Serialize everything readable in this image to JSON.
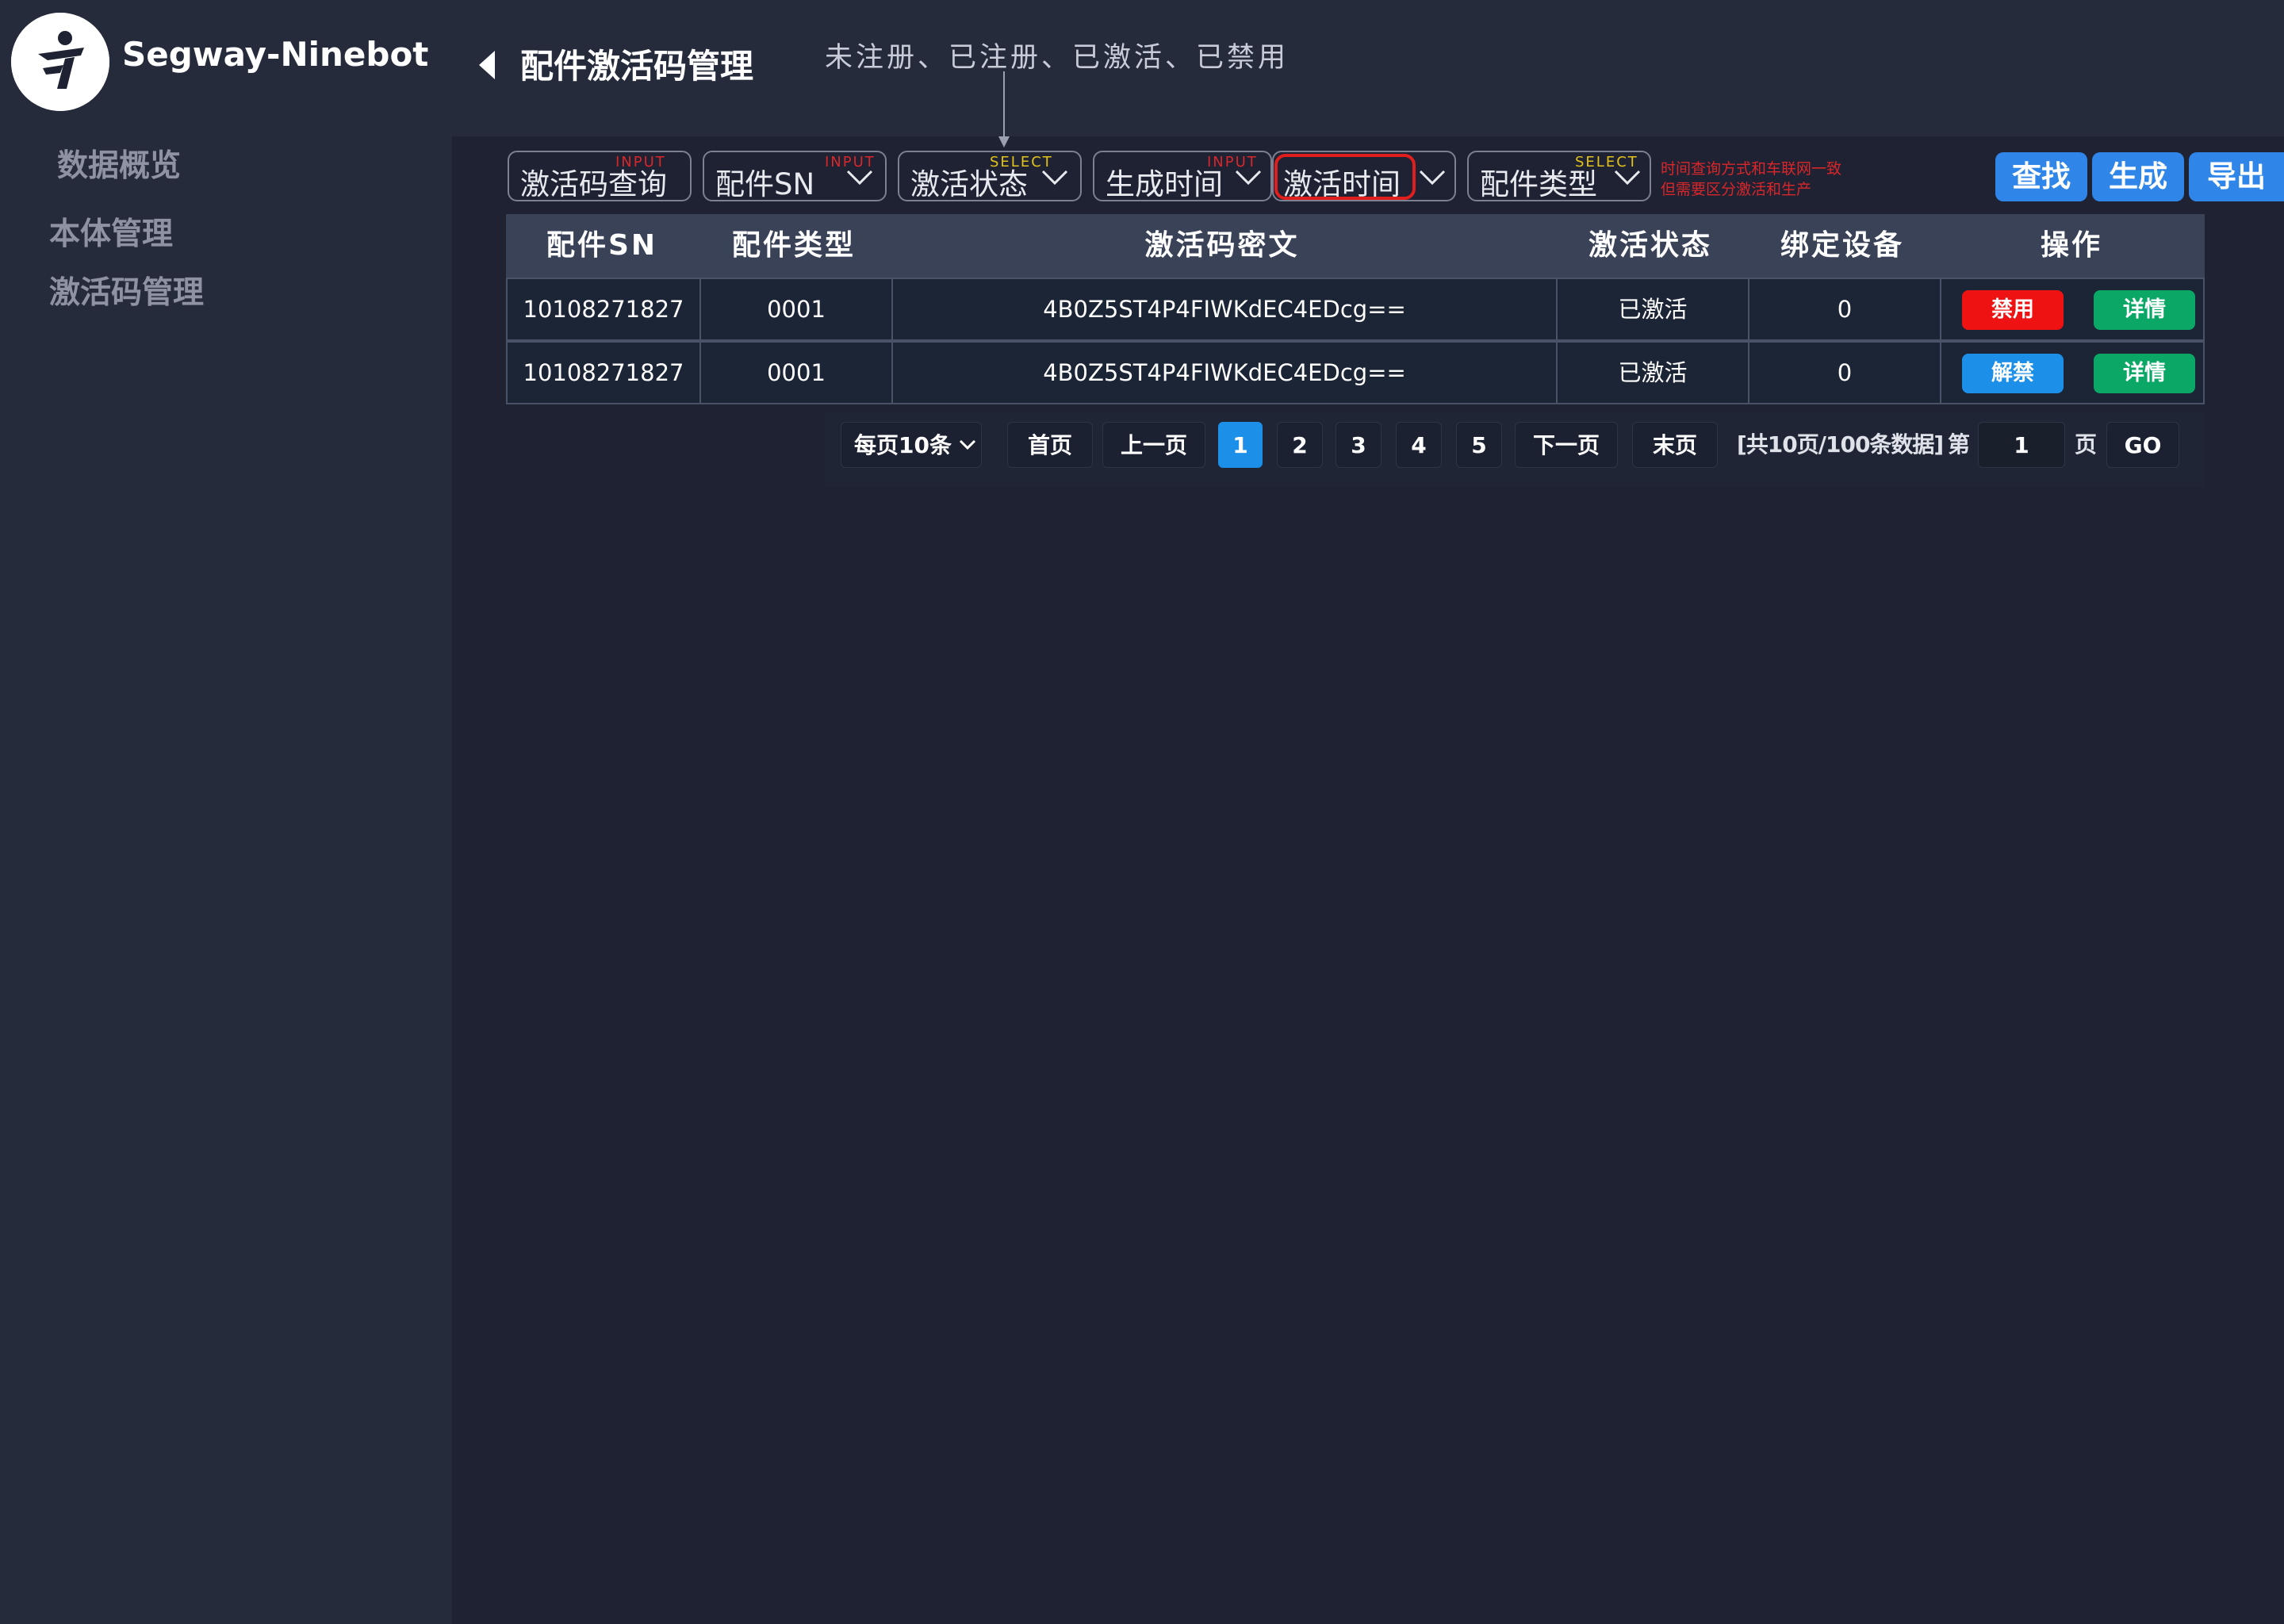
{
  "header": {
    "brand": "Segway-Ninebot",
    "page_title": "配件激活码管理",
    "annotation": "未注册、已注册、已激活、已禁用"
  },
  "sidebar": {
    "items": [
      {
        "label": "数据概览"
      },
      {
        "label": "本体管理"
      },
      {
        "label": "激活码管理"
      }
    ]
  },
  "filters": [
    {
      "label": "激活码查询",
      "tag": "INPUT",
      "tag_color": "#d9262a"
    },
    {
      "label": "配件SN",
      "tag": "INPUT",
      "tag_color": "#d9262a"
    },
    {
      "label": "激活状态",
      "tag": "SELECT",
      "tag_color": "#e2c21b"
    },
    {
      "label": "生成时间",
      "tag": "INPUT",
      "tag_color": "#d9262a"
    },
    {
      "label": "激活时间",
      "tag": "",
      "tag_color": ""
    },
    {
      "label": "配件类型",
      "tag": "SELECT",
      "tag_color": "#e2c21b"
    }
  ],
  "note": {
    "line1": "时间查询方式和车联网一致",
    "line2": "但需要区分激活和生产"
  },
  "actions": {
    "search": "查找",
    "generate": "生成",
    "export": "导出"
  },
  "table": {
    "headers": [
      "配件SN",
      "配件类型",
      "激活码密文",
      "激活状态",
      "绑定设备",
      "操作"
    ],
    "rows": [
      {
        "sn": "10108271827",
        "type": "0001",
        "cipher": "4B0Z5ST4P4FIWKdEC4EDcg==",
        "status": "已激活",
        "device": "0",
        "op1": "禁用",
        "op1_color": "#ee1212",
        "op2": "详情"
      },
      {
        "sn": "10108271827",
        "type": "0001",
        "cipher": "4B0Z5ST4P4FIWKdEC4EDcg==",
        "status": "已激活",
        "device": "0",
        "op1": "解禁",
        "op1_color": "#1c8fe8",
        "op2": "详情"
      }
    ]
  },
  "pagination": {
    "page_size": "每页10条",
    "first": "首页",
    "prev": "上一页",
    "pages": [
      "1",
      "2",
      "3",
      "4",
      "5"
    ],
    "current": "1",
    "next": "下一页",
    "last": "末页",
    "summary": "[共10页/100条数据]",
    "jump_prefix": "第",
    "jump_value": "1",
    "jump_suffix": "页",
    "go": "GO"
  },
  "colors": {
    "background": "#1e2232",
    "panel": "#262b3c",
    "primary": "#2f86e8",
    "danger": "#ee1212",
    "success": "#0aa767"
  }
}
